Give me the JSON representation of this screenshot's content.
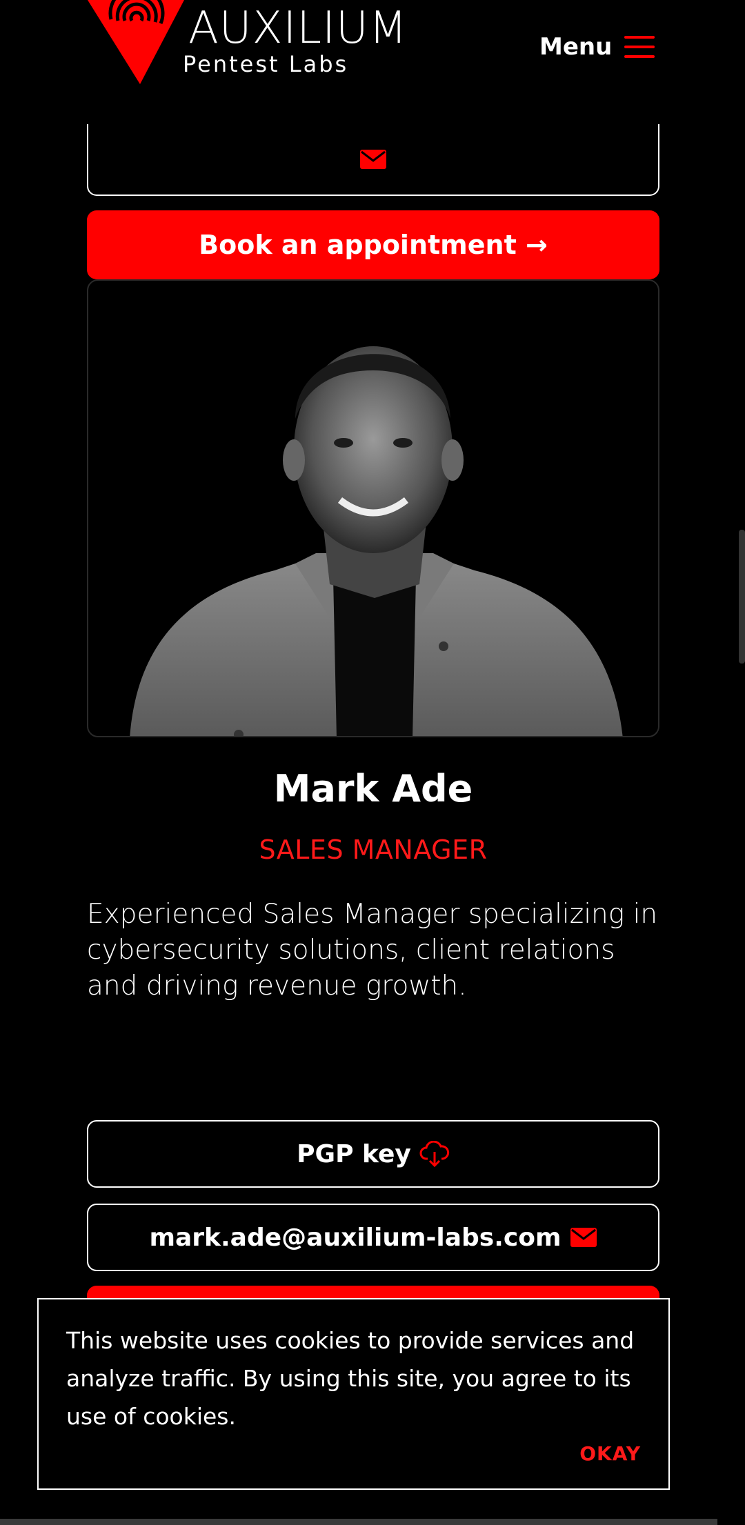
{
  "header": {
    "logo_title": "AUXILIUM",
    "logo_subtitle": "Pentest Labs",
    "menu_label": "Menu"
  },
  "colors": {
    "accent": "#ff0000",
    "background": "#000000",
    "text": "#ffffff"
  },
  "top_actions": {
    "email_icon": "mail-icon",
    "book_label": "Book an appointment →"
  },
  "profile": {
    "name": "Mark Ade",
    "role": "SALES MANAGER",
    "bio": "Experienced Sales Manager specializing in cybersecurity solutions, client relations and driving revenue growth."
  },
  "contact": {
    "pgp_label": "PGP key",
    "pgp_icon": "cloud-download-icon",
    "email": "mark.ade@auxilium-labs.com",
    "email_icon": "mail-icon"
  },
  "cookie_banner": {
    "text": "This website uses cookies to provide services and analyze traffic. By using this site, you agree to its use of cookies.",
    "ok_label": "OKAY"
  }
}
